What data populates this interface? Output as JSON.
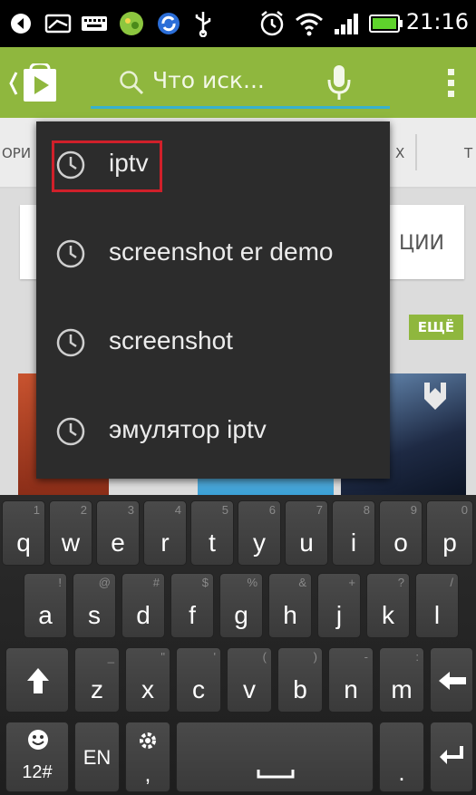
{
  "status_bar": {
    "time": "21:16",
    "icons": [
      "back-arrow-notify-icon",
      "message-icon",
      "keyboard-notify-icon",
      "app-notify-icon",
      "sync-icon",
      "usb-icon",
      "alarm-icon",
      "wifi-icon",
      "signal-icon",
      "battery-icon"
    ]
  },
  "action_bar": {
    "search_placeholder": "Что иск...",
    "accent_color": "#8fb73e",
    "underline_color": "#37b1d0"
  },
  "background": {
    "tab_left": "ОРИ",
    "tab_right_1": "Х",
    "tab_right_2": "Т",
    "card_text": "ЦИИ",
    "more_badge": "ЕЩЁ"
  },
  "suggestions": [
    {
      "label": "iptv",
      "icon": "history-clock-icon"
    },
    {
      "label": "screenshot er demo",
      "icon": "history-clock-icon"
    },
    {
      "label": "screenshot",
      "icon": "history-clock-icon"
    },
    {
      "label": "эмулятор iptv",
      "icon": "history-clock-icon"
    }
  ],
  "keyboard": {
    "row1": [
      {
        "label": "q",
        "hint": "1"
      },
      {
        "label": "w",
        "hint": "2"
      },
      {
        "label": "e",
        "hint": "3"
      },
      {
        "label": "r",
        "hint": "4"
      },
      {
        "label": "t",
        "hint": "5"
      },
      {
        "label": "y",
        "hint": "6"
      },
      {
        "label": "u",
        "hint": "7"
      },
      {
        "label": "i",
        "hint": "8"
      },
      {
        "label": "o",
        "hint": "9"
      },
      {
        "label": "p",
        "hint": "0"
      }
    ],
    "row2": [
      {
        "label": "a",
        "hint": "!"
      },
      {
        "label": "s",
        "hint": "@"
      },
      {
        "label": "d",
        "hint": "#"
      },
      {
        "label": "f",
        "hint": "$"
      },
      {
        "label": "g",
        "hint": "%"
      },
      {
        "label": "h",
        "hint": "&"
      },
      {
        "label": "j",
        "hint": "+"
      },
      {
        "label": "k",
        "hint": "?"
      },
      {
        "label": "l",
        "hint": "/"
      }
    ],
    "row3": [
      {
        "label": "z",
        "hint": "_"
      },
      {
        "label": "x",
        "hint": "\""
      },
      {
        "label": "c",
        "hint": "'"
      },
      {
        "label": "v",
        "hint": "("
      },
      {
        "label": "b",
        "hint": ")"
      },
      {
        "label": "n",
        "hint": "-"
      },
      {
        "label": "m",
        "hint": ":"
      }
    ],
    "symbols_label": "12#",
    "language_label": "EN",
    "comma_label": ",",
    "period_label": "."
  }
}
